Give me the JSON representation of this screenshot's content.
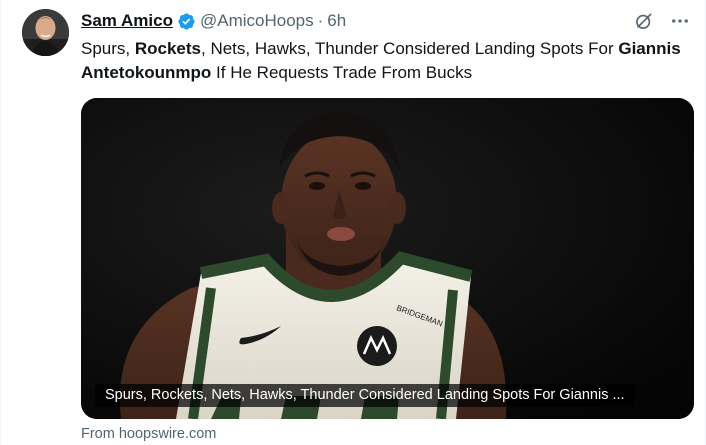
{
  "author": {
    "name": "Sam Amico",
    "handle": "@AmicoHoops",
    "separator": "·",
    "time": "6h"
  },
  "tweet": {
    "text_1": "Spurs, ",
    "text_bold_1": "Rockets",
    "text_2": ", Nets, Hawks, Thunder Considered Landing Spots For ",
    "text_bold_2": "Giannis Antetokounmpo",
    "text_3": " If He Requests Trade From Bucks"
  },
  "card": {
    "caption": "Spurs, Rockets, Nets, Hawks, Thunder Considered Landing Spots For Giannis ...",
    "source": "From hoopswire.com",
    "jersey_partner": "BRIDGEMAN"
  },
  "icons": {
    "verified": "verified-badge-icon",
    "grok": "grok-icon",
    "more": "more-icon"
  },
  "colors": {
    "verified_blue": "#1d9bf0",
    "secondary_text": "#536471",
    "jersey_green": "#2e4a2c"
  }
}
